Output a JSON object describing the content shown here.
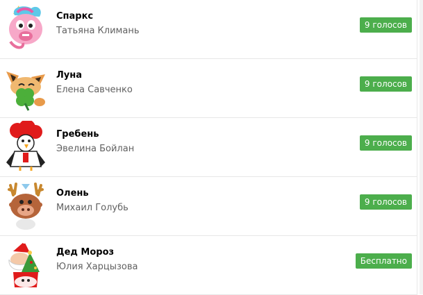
{
  "stickers": [
    {
      "title": "Спаркс",
      "author": "Татьяна Климань",
      "price": "9 голосов",
      "icon": "unicorn-sticker-icon"
    },
    {
      "title": "Луна",
      "author": "Елена Савченко",
      "price": "9 голосов",
      "icon": "fox-clover-sticker-icon"
    },
    {
      "title": "Гребень",
      "author": "Эвелина Бойлан",
      "price": "9 голосов",
      "icon": "rooster-sticker-icon"
    },
    {
      "title": "Олень",
      "author": "Михаил Голубь",
      "price": "9 голосов",
      "icon": "deer-sticker-icon"
    },
    {
      "title": "Дед Мороз",
      "author": "Юлия Харцызова",
      "price": "Бесплатно",
      "icon": "santa-sticker-icon"
    }
  ],
  "colors": {
    "button": "#4cae4c",
    "author_text": "#606060",
    "divider": "#e7e7e7"
  }
}
